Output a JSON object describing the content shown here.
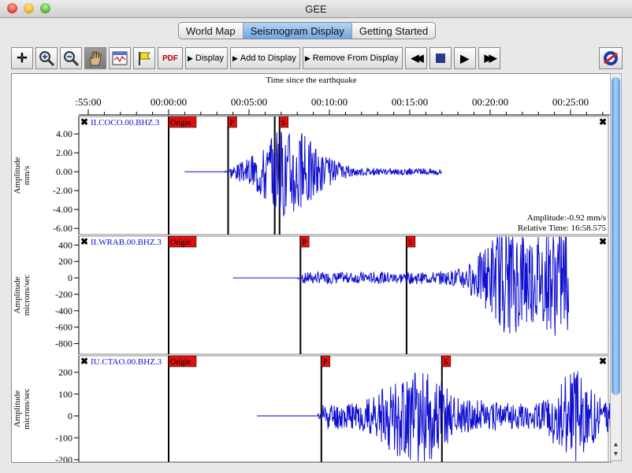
{
  "window": {
    "title": "GEE"
  },
  "tabs": [
    {
      "label": "World Map",
      "active": false
    },
    {
      "label": "Seismogram Display",
      "active": true
    },
    {
      "label": "Getting Started",
      "active": false
    }
  ],
  "toolbar": {
    "pdf_label": "PDF",
    "display_label": "Display",
    "add_label": "Add to Display",
    "remove_label": "Remove From Display"
  },
  "time_axis": {
    "title": "Time since the earthquake",
    "ticks": [
      {
        "label": ":55:00",
        "min": -5
      },
      {
        "label": "00:00:00",
        "min": 0
      },
      {
        "label": "00:05:00",
        "min": 5
      },
      {
        "label": "00:10:00",
        "min": 10
      },
      {
        "label": "00:15:00",
        "min": 15
      },
      {
        "label": "00:20:00",
        "min": 20
      },
      {
        "label": "00:25:00",
        "min": 25
      }
    ]
  },
  "seismograms": [
    {
      "station": "II.COCO.00.BHZ.3",
      "ylabel1": "Amplitude",
      "ylabel2": "mm/s",
      "ylim": [
        -6.4,
        5.6
      ],
      "yticks": [
        {
          "label": "4.00",
          "v": 4
        },
        {
          "label": "2.00",
          "v": 2
        },
        {
          "label": "0.00",
          "v": 0
        },
        {
          "label": "-2.00",
          "v": -2
        },
        {
          "label": "-4.00",
          "v": -4
        },
        {
          "label": "-6.00",
          "v": -6
        }
      ],
      "signal": {
        "start": 1.0,
        "end": 17.0,
        "flat_end": 3.8,
        "noise": 0.35,
        "burst1": 7.5,
        "burst2": 99,
        "amp": 4.5,
        "seed": 3
      },
      "markers": [
        {
          "label": "Origin",
          "min": 0
        },
        {
          "label": "P",
          "min": 3.7
        },
        {
          "label": "",
          "min": 6.6
        },
        {
          "label": "S",
          "min": 6.9
        }
      ],
      "readout": {
        "amplitude": "Amplitude:-0.92 mm/s",
        "time": "Relative Time: 16:58.575"
      }
    },
    {
      "station": "II.WRAB.00.BHZ.3",
      "ylabel1": "Amplitude",
      "ylabel2": "microns/sec",
      "ylim": [
        -900,
        480
      ],
      "yticks": [
        {
          "label": "400",
          "v": 400
        },
        {
          "label": "200",
          "v": 200
        },
        {
          "label": "0",
          "v": 0
        },
        {
          "label": "-200",
          "v": -200
        },
        {
          "label": "-400",
          "v": -400
        },
        {
          "label": "-600",
          "v": -600
        },
        {
          "label": "-800",
          "v": -800
        }
      ],
      "signal": {
        "start": 4.0,
        "end": 24.9,
        "flat_end": 8.3,
        "noise": 70,
        "burst1": 21.5,
        "burst2": 24.5,
        "amp": 600,
        "seed": 7
      },
      "markers": [
        {
          "label": "Origin",
          "min": 0
        },
        {
          "label": "P",
          "min": 8.2
        },
        {
          "label": "S",
          "min": 14.8
        }
      ],
      "readout": null
    },
    {
      "station": "IU.CTAO.00.BHZ.3",
      "ylabel1": "Amplitude",
      "ylabel2": "microns/sec",
      "ylim": [
        -200,
        265
      ],
      "yticks": [
        {
          "label": "200",
          "v": 200
        },
        {
          "label": "100",
          "v": 100
        },
        {
          "label": "0",
          "v": 0
        },
        {
          "label": "-100",
          "v": -100
        },
        {
          "label": "-200",
          "v": -200
        }
      ],
      "signal": {
        "start": 5.5,
        "end": 27.7,
        "flat_end": 9.6,
        "noise": 60,
        "burst1": 15.5,
        "burst2": 25.2,
        "amp": 160,
        "seed": 11
      },
      "markers": [
        {
          "label": "Origin",
          "min": 0
        },
        {
          "label": "P",
          "min": 9.5
        },
        {
          "label": "S",
          "min": 17.0
        }
      ],
      "readout": null
    }
  ],
  "colors": {
    "trace": "#1010d0",
    "marker_fill": "#e01010",
    "station_text": "#1010d0"
  }
}
